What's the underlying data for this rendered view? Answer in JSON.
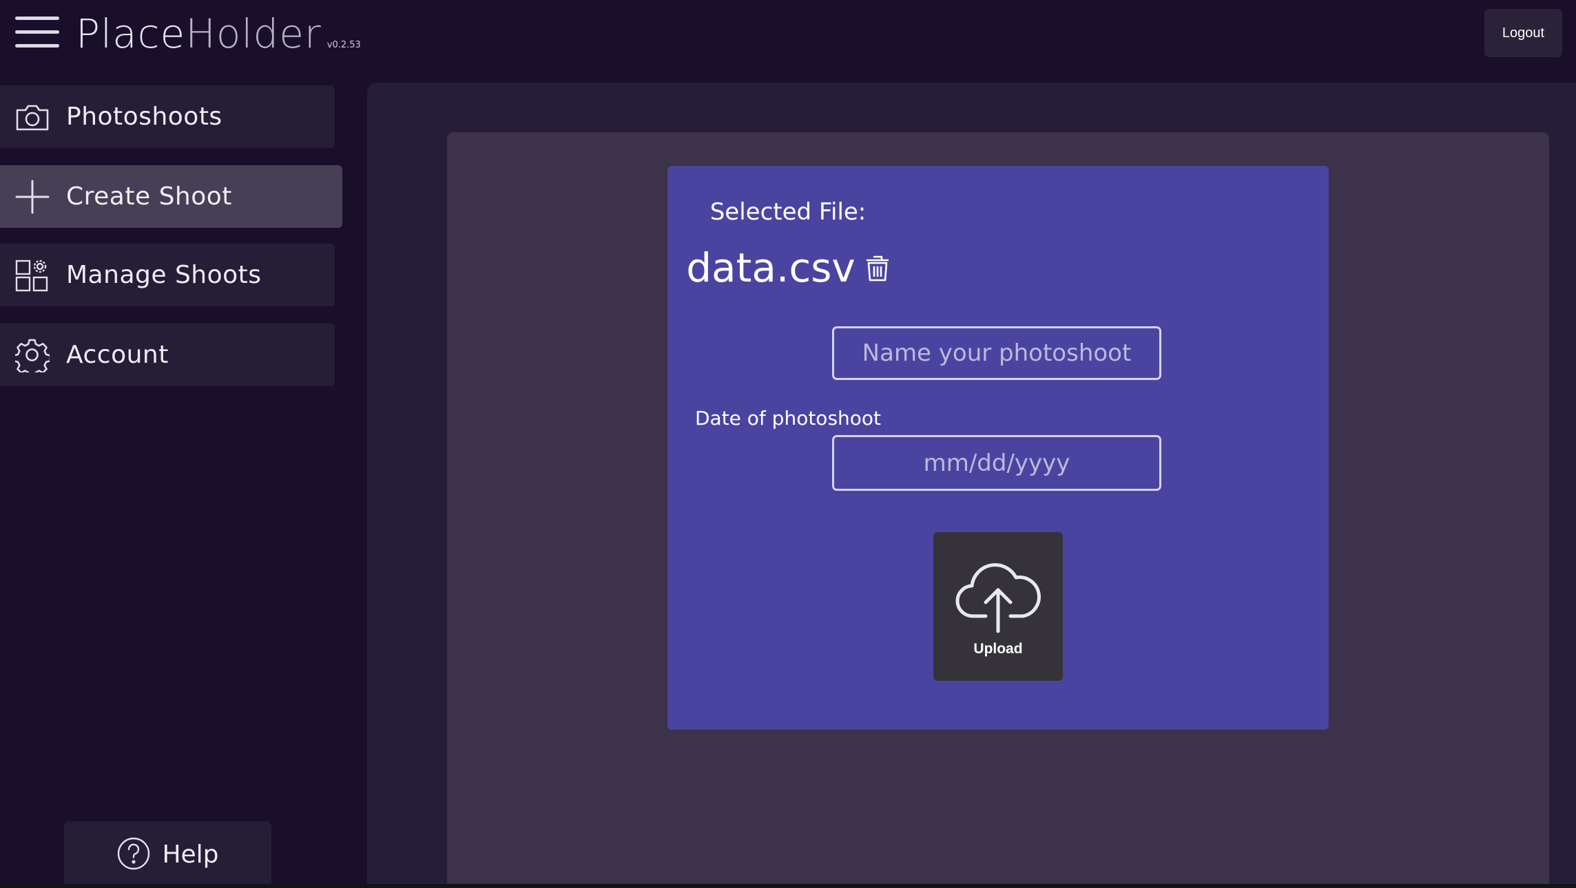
{
  "header": {
    "brand_part1": "Place",
    "brand_part2": "Holder",
    "version": "v0.2.53",
    "logout_label": "Logout"
  },
  "sidebar": {
    "items": [
      {
        "label": "Photoshoots",
        "icon": "camera-icon",
        "active": false
      },
      {
        "label": "Create Shoot",
        "icon": "plus-icon",
        "active": true
      },
      {
        "label": "Manage Shoots",
        "icon": "grid-gear-icon",
        "active": false
      },
      {
        "label": "Account",
        "icon": "gear-icon",
        "active": false
      }
    ],
    "help_label": "Help"
  },
  "form": {
    "selected_file_label": "Selected File:",
    "file_name": "data.csv",
    "name_placeholder": "Name your photoshoot",
    "date_label": "Date of photoshoot",
    "date_placeholder": "mm/dd/yyyy",
    "upload_label": "Upload"
  },
  "colors": {
    "background": "#190f2b",
    "sidebar_item": "#261d36",
    "sidebar_active": "#463f55",
    "panel_outer": "#261e38",
    "panel_inner": "#3c3249",
    "card": "#4a44a1",
    "upload_button": "#353339"
  }
}
